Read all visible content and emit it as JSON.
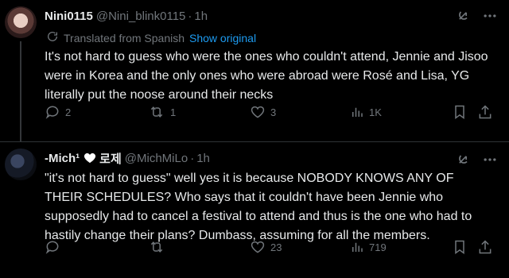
{
  "tweets": [
    {
      "name": "Nini0115",
      "handle": "@Nini_blink0115",
      "separator": "·",
      "time": "1h",
      "translated_label": "Translated from Spanish",
      "show_original": "Show original",
      "text": "It's not hard to guess who were the ones who couldn't attend, Jennie and Jisoo were in Korea and the only ones who were abroad were Rosé and Lisa, YG literally put the noose around their necks",
      "replies": "2",
      "reposts": "1",
      "likes": "3",
      "views": "1K"
    },
    {
      "name": "-Mich¹",
      "name_suffix": "로제",
      "handle": "@MichMiLo",
      "separator": "·",
      "time": "1h",
      "text": "\"it's not hard to guess\" well yes it is because NOBODY KNOWS ANY OF THEIR SCHEDULES? Who says that it couldn't have been Jennie who supposedly had to cancel a festival to attend and thus is the one who had to hastily change their plans? Dumbass, assuming for all the members.",
      "replies": "",
      "reposts": "",
      "likes": "23",
      "views": "719"
    }
  ],
  "icons": {
    "grok": "grok-icon",
    "more": "more-icon",
    "translate": "translate-icon",
    "reply": "reply-icon",
    "repost": "repost-icon",
    "like": "like-icon",
    "views": "views-icon",
    "bookmark": "bookmark-icon",
    "share": "share-icon",
    "heart_badge": "white-heart-icon"
  },
  "colors": {
    "background": "#000000",
    "text": "#e7e9ea",
    "secondary": "#71767b",
    "link": "#1d9bf0"
  }
}
